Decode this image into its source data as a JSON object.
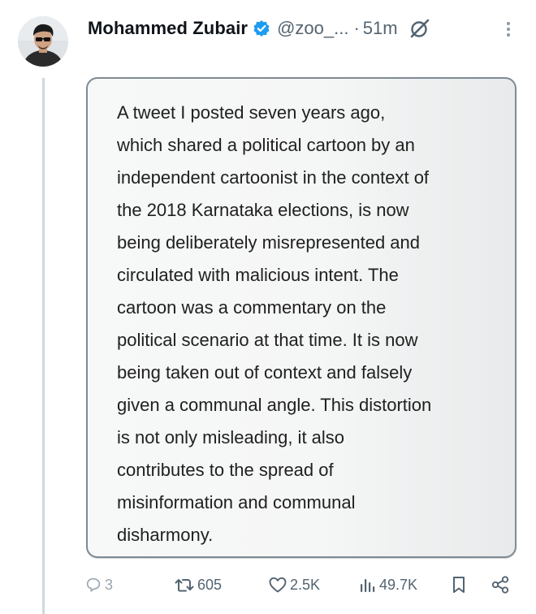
{
  "tweet": {
    "author": {
      "name": "Mohammed Zubair",
      "handle": "@zoo_...",
      "verified": true,
      "avatar_icon": "user-avatar"
    },
    "separator": "·",
    "time": "51m",
    "image_text": "A tweet I posted seven years ago,\nwhich shared a political cartoon by an\nindependent cartoonist in the context of\nthe 2018 Karnataka elections, is now\nbeing deliberately misrepresented and\ncirculated with malicious intent. The\ncartoon was a commentary on the\npolitical scenario at that time. It is now\nbeing taken out of context and falsely\ngiven a communal angle. This distortion\nis not only misleading, it also\ncontributes to the spread of\nmisinformation and communal\ndisharmony.",
    "actions": {
      "replies": "3",
      "retweets": "605",
      "likes": "2.5K",
      "views": "49.7K"
    },
    "icons": [
      "verified-badge-icon",
      "grok-icon",
      "more-icon",
      "reply-icon",
      "retweet-icon",
      "like-icon",
      "views-icon",
      "bookmark-icon",
      "share-icon"
    ],
    "colors": {
      "verified": "#1d9bf0",
      "muted": "#536471",
      "thread_line": "#cfd9de"
    }
  }
}
